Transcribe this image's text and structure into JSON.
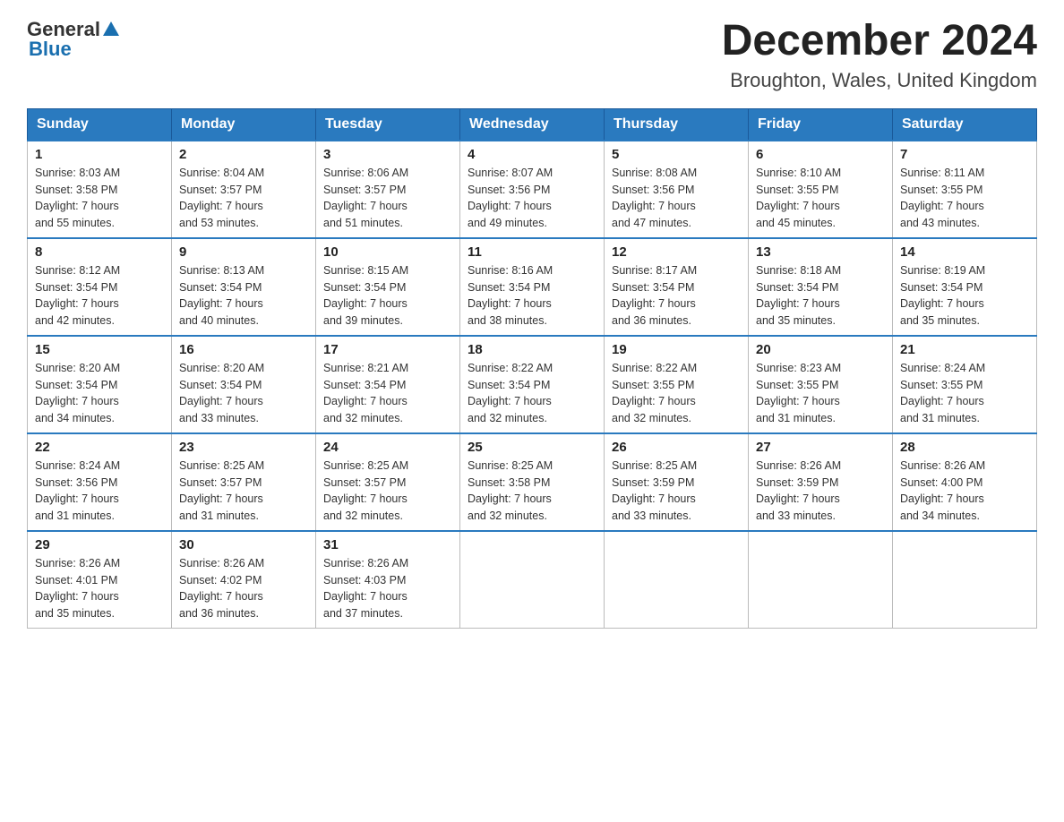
{
  "header": {
    "logo_general": "General",
    "logo_blue": "Blue",
    "month_year": "December 2024",
    "location": "Broughton, Wales, United Kingdom"
  },
  "days_of_week": [
    "Sunday",
    "Monday",
    "Tuesday",
    "Wednesday",
    "Thursday",
    "Friday",
    "Saturday"
  ],
  "weeks": [
    [
      {
        "day": "1",
        "sunrise": "8:03 AM",
        "sunset": "3:58 PM",
        "daylight": "7 hours and 55 minutes."
      },
      {
        "day": "2",
        "sunrise": "8:04 AM",
        "sunset": "3:57 PM",
        "daylight": "7 hours and 53 minutes."
      },
      {
        "day": "3",
        "sunrise": "8:06 AM",
        "sunset": "3:57 PM",
        "daylight": "7 hours and 51 minutes."
      },
      {
        "day": "4",
        "sunrise": "8:07 AM",
        "sunset": "3:56 PM",
        "daylight": "7 hours and 49 minutes."
      },
      {
        "day": "5",
        "sunrise": "8:08 AM",
        "sunset": "3:56 PM",
        "daylight": "7 hours and 47 minutes."
      },
      {
        "day": "6",
        "sunrise": "8:10 AM",
        "sunset": "3:55 PM",
        "daylight": "7 hours and 45 minutes."
      },
      {
        "day": "7",
        "sunrise": "8:11 AM",
        "sunset": "3:55 PM",
        "daylight": "7 hours and 43 minutes."
      }
    ],
    [
      {
        "day": "8",
        "sunrise": "8:12 AM",
        "sunset": "3:54 PM",
        "daylight": "7 hours and 42 minutes."
      },
      {
        "day": "9",
        "sunrise": "8:13 AM",
        "sunset": "3:54 PM",
        "daylight": "7 hours and 40 minutes."
      },
      {
        "day": "10",
        "sunrise": "8:15 AM",
        "sunset": "3:54 PM",
        "daylight": "7 hours and 39 minutes."
      },
      {
        "day": "11",
        "sunrise": "8:16 AM",
        "sunset": "3:54 PM",
        "daylight": "7 hours and 38 minutes."
      },
      {
        "day": "12",
        "sunrise": "8:17 AM",
        "sunset": "3:54 PM",
        "daylight": "7 hours and 36 minutes."
      },
      {
        "day": "13",
        "sunrise": "8:18 AM",
        "sunset": "3:54 PM",
        "daylight": "7 hours and 35 minutes."
      },
      {
        "day": "14",
        "sunrise": "8:19 AM",
        "sunset": "3:54 PM",
        "daylight": "7 hours and 35 minutes."
      }
    ],
    [
      {
        "day": "15",
        "sunrise": "8:20 AM",
        "sunset": "3:54 PM",
        "daylight": "7 hours and 34 minutes."
      },
      {
        "day": "16",
        "sunrise": "8:20 AM",
        "sunset": "3:54 PM",
        "daylight": "7 hours and 33 minutes."
      },
      {
        "day": "17",
        "sunrise": "8:21 AM",
        "sunset": "3:54 PM",
        "daylight": "7 hours and 32 minutes."
      },
      {
        "day": "18",
        "sunrise": "8:22 AM",
        "sunset": "3:54 PM",
        "daylight": "7 hours and 32 minutes."
      },
      {
        "day": "19",
        "sunrise": "8:22 AM",
        "sunset": "3:55 PM",
        "daylight": "7 hours and 32 minutes."
      },
      {
        "day": "20",
        "sunrise": "8:23 AM",
        "sunset": "3:55 PM",
        "daylight": "7 hours and 31 minutes."
      },
      {
        "day": "21",
        "sunrise": "8:24 AM",
        "sunset": "3:55 PM",
        "daylight": "7 hours and 31 minutes."
      }
    ],
    [
      {
        "day": "22",
        "sunrise": "8:24 AM",
        "sunset": "3:56 PM",
        "daylight": "7 hours and 31 minutes."
      },
      {
        "day": "23",
        "sunrise": "8:25 AM",
        "sunset": "3:57 PM",
        "daylight": "7 hours and 31 minutes."
      },
      {
        "day": "24",
        "sunrise": "8:25 AM",
        "sunset": "3:57 PM",
        "daylight": "7 hours and 32 minutes."
      },
      {
        "day": "25",
        "sunrise": "8:25 AM",
        "sunset": "3:58 PM",
        "daylight": "7 hours and 32 minutes."
      },
      {
        "day": "26",
        "sunrise": "8:25 AM",
        "sunset": "3:59 PM",
        "daylight": "7 hours and 33 minutes."
      },
      {
        "day": "27",
        "sunrise": "8:26 AM",
        "sunset": "3:59 PM",
        "daylight": "7 hours and 33 minutes."
      },
      {
        "day": "28",
        "sunrise": "8:26 AM",
        "sunset": "4:00 PM",
        "daylight": "7 hours and 34 minutes."
      }
    ],
    [
      {
        "day": "29",
        "sunrise": "8:26 AM",
        "sunset": "4:01 PM",
        "daylight": "7 hours and 35 minutes."
      },
      {
        "day": "30",
        "sunrise": "8:26 AM",
        "sunset": "4:02 PM",
        "daylight": "7 hours and 36 minutes."
      },
      {
        "day": "31",
        "sunrise": "8:26 AM",
        "sunset": "4:03 PM",
        "daylight": "7 hours and 37 minutes."
      },
      null,
      null,
      null,
      null
    ]
  ]
}
